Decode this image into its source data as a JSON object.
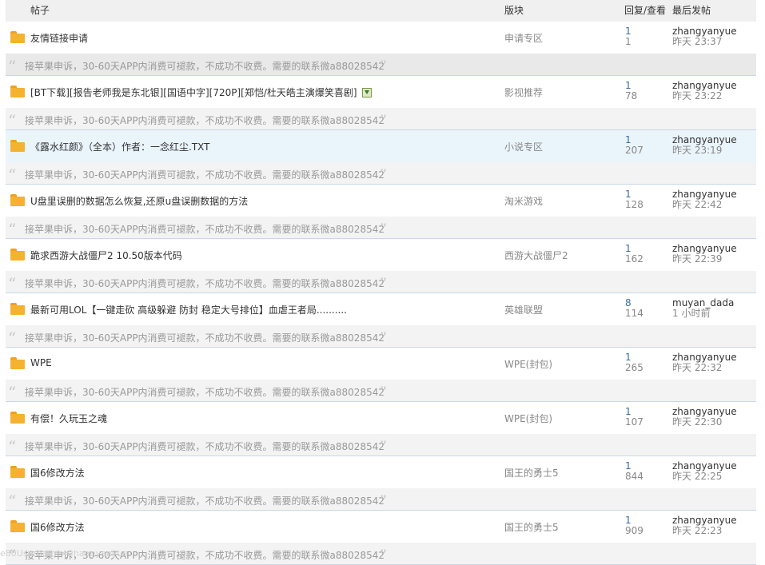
{
  "header": {
    "col_title": "帖子",
    "col_forum": "版块",
    "col_stats": "回复/查看",
    "col_last": "最后发帖"
  },
  "quote_text": "接苹果申诉，30-60天APP内消费可褪款，不成功不收费。需要的联系微a88028542",
  "threads": [
    {
      "title": "友情链接申请",
      "forum": "申请专区",
      "replies": "1",
      "views": "1",
      "last_user": "zhangyanyue",
      "last_time": "昨天 23:37"
    },
    {
      "title": "[BT下载][报告老师我是东北银][国语中字][720P][郑恺/杜天皓主演爆笑喜剧]",
      "forum": "影视推荐",
      "replies": "1",
      "views": "78",
      "last_user": "zhangyanyue",
      "last_time": "昨天 23:22",
      "has_download_icon": true
    },
    {
      "title": "《露水红颜》（全本）作者：一念红尘.TXT",
      "forum": "小说专区",
      "replies": "1",
      "views": "207",
      "last_user": "zhangyanyue",
      "last_time": "昨天 23:19"
    },
    {
      "title": "U盘里误删的数据怎么恢复,还原u盘误删数据的方法",
      "forum": "淘米游戏",
      "replies": "1",
      "views": "128",
      "last_user": "zhangyanyue",
      "last_time": "昨天 22:42"
    },
    {
      "title": "跪求西游大战僵尸2 10.50版本代码",
      "forum": "西游大战僵尸2",
      "replies": "1",
      "views": "162",
      "last_user": "zhangyanyue",
      "last_time": "昨天 22:39"
    },
    {
      "title": "最新可用LOL【一键走砍 高级躲避 防封 稳定大号排位】血虐王者局..........",
      "forum": "英雄联盟",
      "replies": "8",
      "views": "114",
      "last_user": "muyan_dada",
      "last_time": "1 小时前"
    },
    {
      "title": "WPE",
      "forum": "WPE(封包)",
      "replies": "1",
      "views": "265",
      "last_user": "zhangyanyue",
      "last_time": "昨天 22:32"
    },
    {
      "title": "有偿！久玩玉之魂",
      "forum": "WPE(封包)",
      "replies": "1",
      "views": "107",
      "last_user": "zhangyanyue",
      "last_time": "昨天 22:30"
    },
    {
      "title": "国6修改方法",
      "forum": "国王的勇士5",
      "replies": "1",
      "views": "844",
      "last_user": "zhangyanyue",
      "last_time": "昨天 22:25"
    },
    {
      "title": "国6修改方法",
      "forum": "国王的勇士5",
      "replies": "1",
      "views": "909",
      "last_user": "zhangyanyue",
      "last_time": "昨天 22:23"
    }
  ],
  "footer_text": "e80Username=zhangyanyue"
}
